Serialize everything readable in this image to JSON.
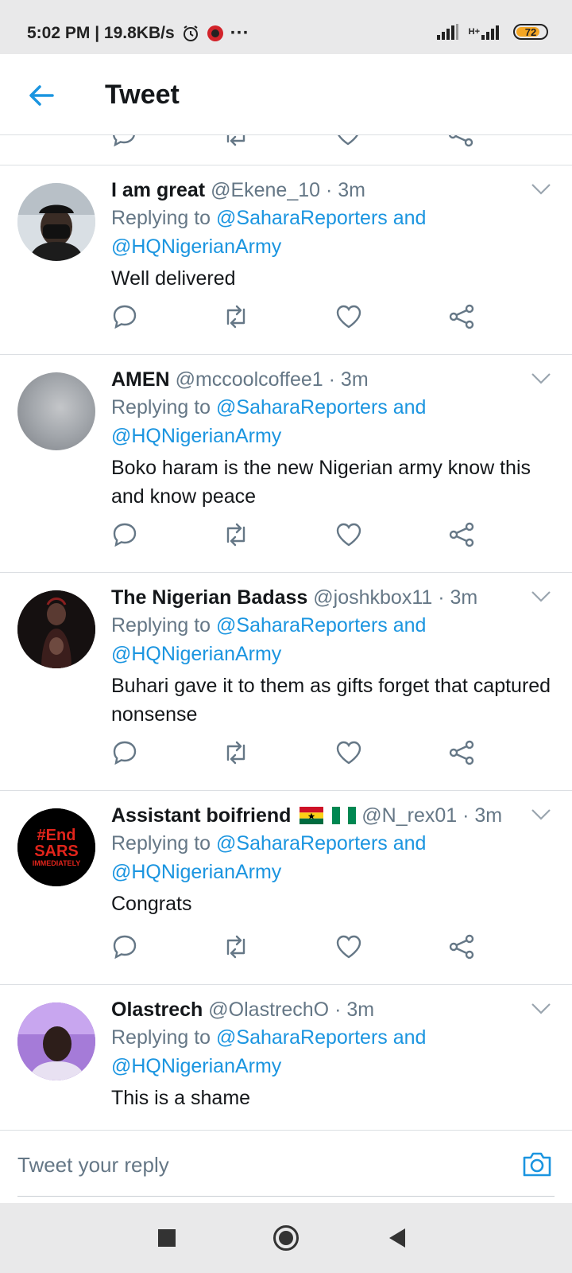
{
  "status_bar": {
    "time_speed": "5:02 PM | 19.8KB/s",
    "more": "···",
    "network_label": "H+",
    "battery": "72"
  },
  "header": {
    "title": "Tweet"
  },
  "tweets": [
    {
      "name": "I am great",
      "handle": "@Ekene_10",
      "time": "· 3m",
      "replying_prefix": "Replying to",
      "mention1": "@SaharaReporters and",
      "mention2": "@HQNigerianArmy",
      "text": "Well delivered",
      "avatar_color": "#cfd6dc"
    },
    {
      "name": "AMEN",
      "handle": "@mccoolcoffee1",
      "time": "· 3m",
      "replying_prefix": "Replying to",
      "mention1": "@SaharaReporters and",
      "mention2": "@HQNigerianArmy",
      "text": "Boko haram is the new Nigerian army know this and know peace",
      "avatar_color": "#9ea3a8"
    },
    {
      "name": "The Nigerian Badass",
      "handle": "@joshkbox11",
      "time": "· 3m",
      "replying_prefix": "Replying to",
      "mention1": "@SaharaReporters and",
      "mention2": "@HQNigerianArmy",
      "text": "Buhari gave it to them as gifts forget that captured nonsense",
      "avatar_color": "#1a1414"
    },
    {
      "name": "Assistant boifriend",
      "handle": "@N_rex01",
      "time": "· 3m",
      "replying_prefix": "Replying to",
      "mention1": "@SaharaReporters and",
      "mention2": "@HQNigerianArmy",
      "text": "Congrats",
      "avatar_color": "#000000",
      "avatar_logo_line1": "#End",
      "avatar_logo_line2": "SARS",
      "avatar_logo_line3": "IMMEDIATELY"
    },
    {
      "name": "Olastrech",
      "handle": "@OlastrechO",
      "time": "· 3m",
      "replying_prefix": "Replying to",
      "mention1": "@SaharaReporters and",
      "mention2": "@HQNigerianArmy",
      "text": "This is a shame",
      "avatar_color": "#8c5fc7"
    }
  ],
  "reply_box": {
    "placeholder": "Tweet your reply"
  },
  "colors": {
    "accent": "#1b95e0",
    "secondary_text": "#657786",
    "primary_text": "#14171a",
    "icon_gray": "#657786"
  }
}
